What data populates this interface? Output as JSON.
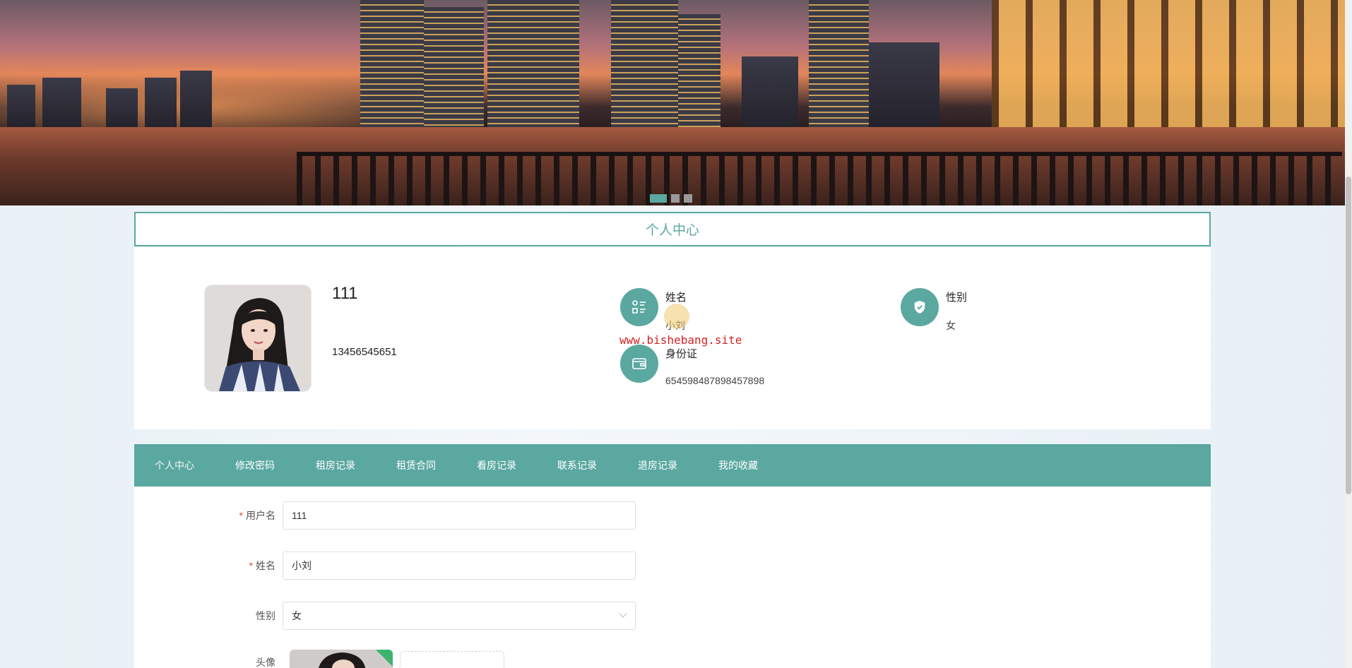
{
  "banner": {
    "slides": 3,
    "active_slide": 1
  },
  "section": {
    "title": "个人中心"
  },
  "profile": {
    "username": "111",
    "phone": "13456545651",
    "fields": [
      {
        "label": "姓名",
        "value": "小刘",
        "icon": "contacts-grid-icon"
      },
      {
        "label": "性别",
        "value": "女",
        "icon": "shield-check-icon"
      },
      {
        "label": "身份证",
        "value": "654598487898457898",
        "icon": "wallet-card-icon"
      }
    ]
  },
  "watermark": "www.bishebang.site",
  "tabs": [
    {
      "label": "个人中心",
      "active": true
    },
    {
      "label": "修改密码"
    },
    {
      "label": "租房记录"
    },
    {
      "label": "租赁合同"
    },
    {
      "label": "看房记录"
    },
    {
      "label": "联系记录"
    },
    {
      "label": "退房记录"
    },
    {
      "label": "我的收藏"
    }
  ],
  "form": {
    "username": {
      "label": "用户名",
      "value": "111",
      "required": "*"
    },
    "name": {
      "label": "姓名",
      "value": "小刘",
      "required": "*"
    },
    "gender": {
      "label": "性别",
      "value": "女"
    },
    "avatar": {
      "label": "头像"
    }
  },
  "colors": {
    "accent": "#5aa8a0",
    "required": "#e0443c",
    "watermark": "#d62222"
  }
}
